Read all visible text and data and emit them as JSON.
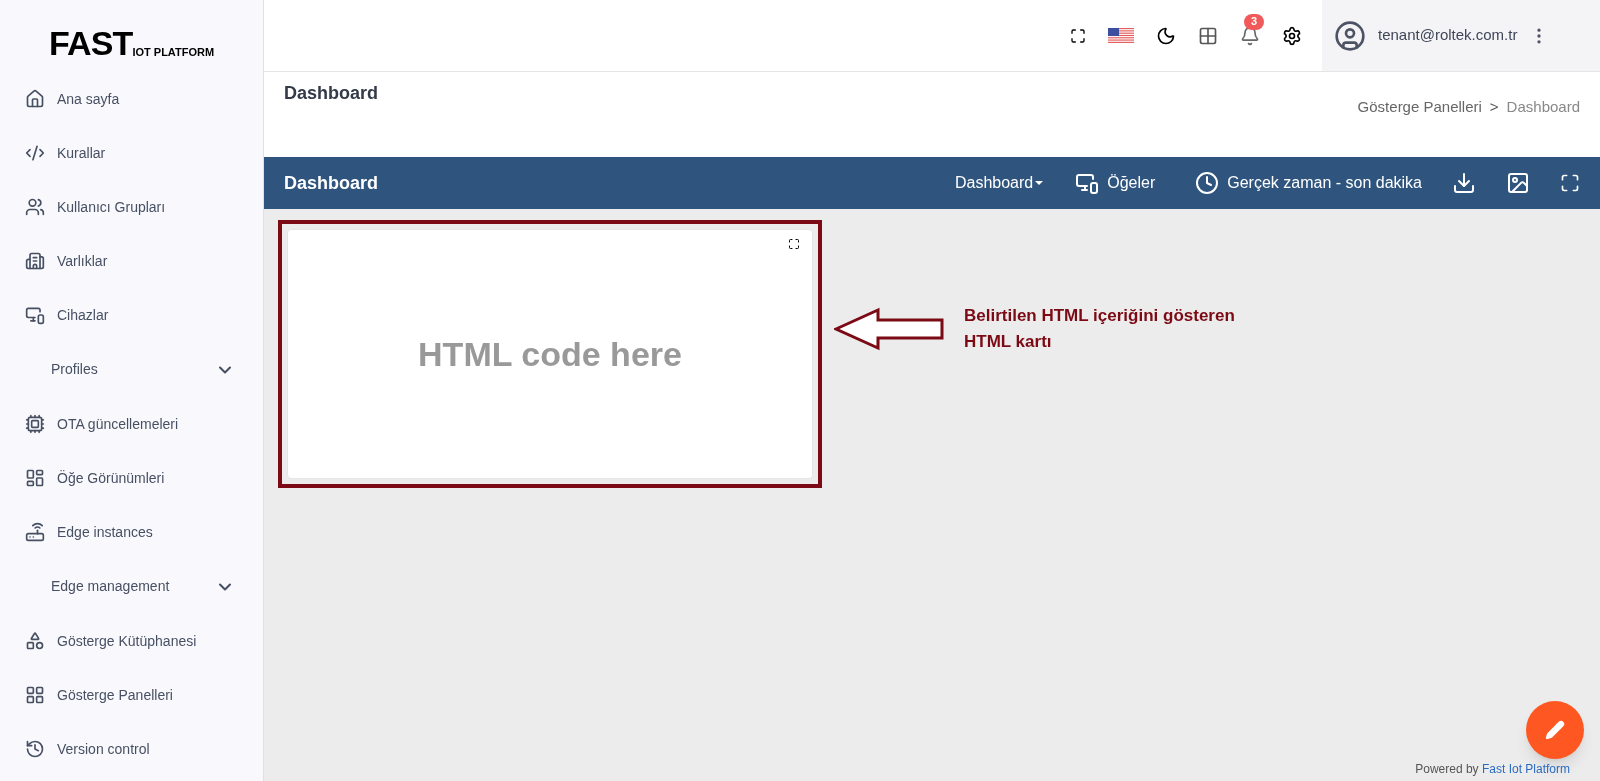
{
  "logo": {
    "main": "FAST",
    "sub": "IOT PLATFORM"
  },
  "sidebar": {
    "items": [
      {
        "kind": "link",
        "label": "Ana sayfa"
      },
      {
        "kind": "link",
        "label": "Kurallar"
      },
      {
        "kind": "link",
        "label": "Kullanıcı Grupları"
      },
      {
        "kind": "link",
        "label": "Varlıklar"
      },
      {
        "kind": "link",
        "label": "Cihazlar"
      },
      {
        "kind": "group",
        "label": "Profiles",
        "expanded": false
      },
      {
        "kind": "link",
        "label": "OTA güncellemeleri"
      },
      {
        "kind": "link",
        "label": "Öğe Görünümleri"
      },
      {
        "kind": "link",
        "label": "Edge instances"
      },
      {
        "kind": "group",
        "label": "Edge management",
        "expanded": false
      },
      {
        "kind": "link",
        "label": "Gösterge Kütüphanesi"
      },
      {
        "kind": "link",
        "label": "Gösterge Panelleri"
      },
      {
        "kind": "link",
        "label": "Version control"
      }
    ]
  },
  "topbar": {
    "notification_count": "3",
    "user": "tenant@roltek.com.tr"
  },
  "page_header": {
    "title": "Dashboard",
    "breadcrumb": [
      "Gösterge Panelleri",
      "Dashboard"
    ],
    "separator": ">"
  },
  "dashboard_bar": {
    "title": "Dashboard",
    "selector": "Dashboard",
    "widgets_button": "Öğeler",
    "timewindow": "Gerçek zaman - son dakika"
  },
  "html_card": {
    "content": "HTML code here"
  },
  "annotation": {
    "text": "Belirtilen HTML içeriğini gösteren HTML kartı"
  },
  "footer": {
    "prefix": "Powered by",
    "link": "Fast Iot Platform"
  }
}
